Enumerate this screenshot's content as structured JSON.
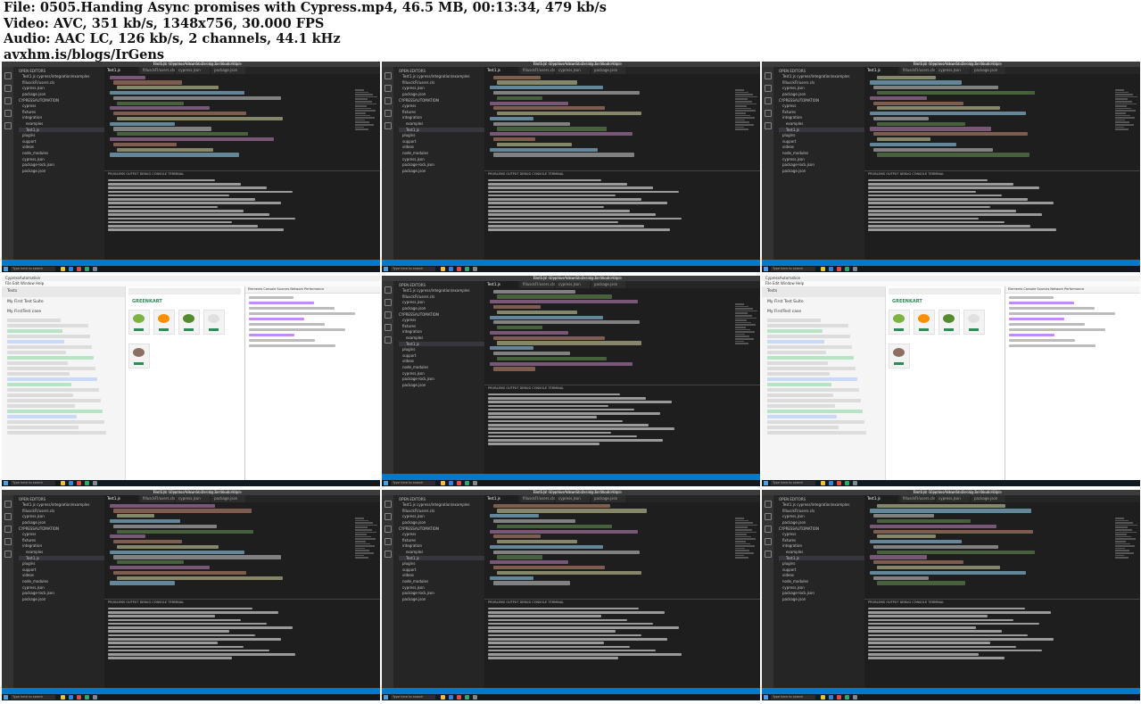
{
  "header": {
    "file_line": "File: 0505.Handing Async promises with Cypress.mp4, 46.5 MB, 00:13:34, 479 kb/s",
    "video_line": "Video: AVC, 351 kb/s, 1348x756, 30.000 FPS",
    "audio_line": "Audio: AAC LC, 126 kb/s, 2 channels, 44.1 kHz",
    "site_line": "avxhm.is/blogs/IrGens"
  },
  "vscode": {
    "title": "Test1.js - CypressAutomation - Visual Studio Code",
    "menu": "File  Edit  Selection  View  Go  Debug  Terminal  Help",
    "explorer_items": [
      "OPEN EDITORS",
      "Test1.js cypress/integration/examples",
      "fillusckFI/users.cls",
      "cypress.json",
      "package.json",
      "CYPRESSAUTOMATION",
      "cypress",
      "fixtures",
      "integration",
      "examples",
      "Test1.js",
      "plugins",
      "support",
      "videos",
      "node_modules",
      "cypress.json",
      "package-lock.json",
      "package.json"
    ],
    "tabs": [
      "Test1.js",
      "fillusckFI/users.cls",
      "cypress.json",
      "package.json"
    ],
    "terminal_tabs": "PROBLEMS   OUTPUT   DEBUG CONSOLE   TERMINAL",
    "search_placeholder": "Type here to search"
  },
  "cypress": {
    "title": "CypressAutomation",
    "menu": "File   Edit   Window   Help",
    "runner_bar": "Tests",
    "suite": "My First Test Suite",
    "test": "My FirstTest case",
    "app_brand": "GREENKART",
    "devtools_tabs": "Elements  Console  Sources  Network  Performance"
  },
  "colors": {
    "keyword": "#c586c0",
    "string": "#ce9178",
    "function": "#dcdcaa",
    "variable": "#9cdcfe",
    "comment": "#6a9955",
    "plain": "#d4d4d4",
    "status_bar": "#007acc"
  }
}
